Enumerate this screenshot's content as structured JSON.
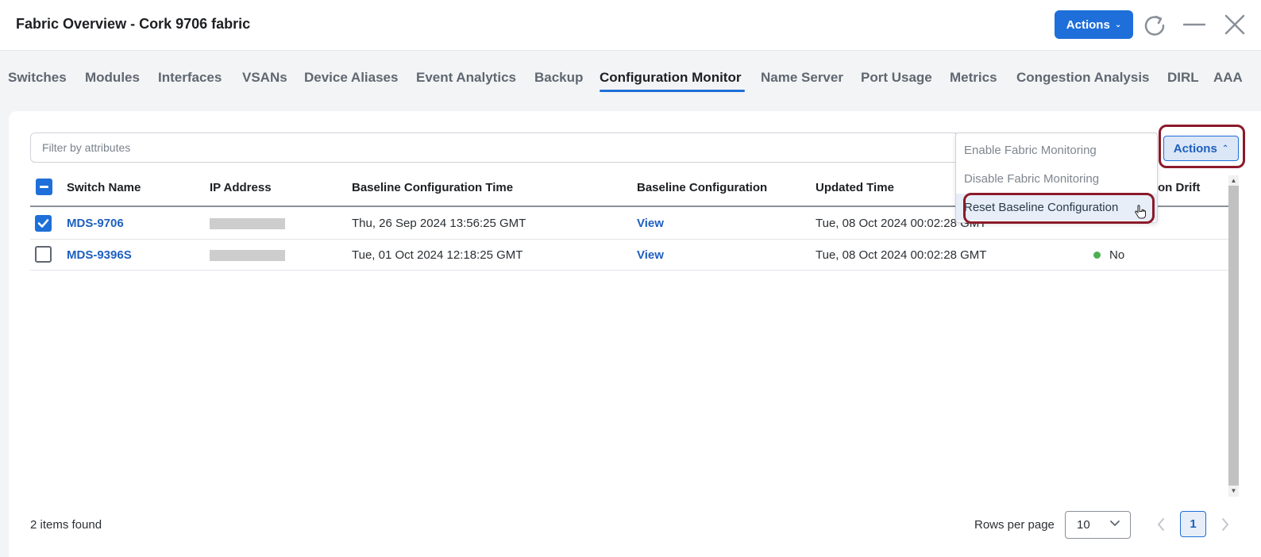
{
  "header": {
    "title": "Fabric Overview - Cork 9706 fabric",
    "actions_label": "Actions"
  },
  "tabs": [
    {
      "label": "Switches"
    },
    {
      "label": "Modules"
    },
    {
      "label": "Interfaces"
    },
    {
      "label": "VSANs"
    },
    {
      "label": "Device Aliases"
    },
    {
      "label": "Event Analytics"
    },
    {
      "label": "Backup"
    },
    {
      "label": "Configuration Monitor",
      "active": true
    },
    {
      "label": "Name Server"
    },
    {
      "label": "Port Usage"
    },
    {
      "label": "Metrics"
    },
    {
      "label": "Congestion Analysis"
    },
    {
      "label": "DIRL"
    },
    {
      "label": "AAA"
    }
  ],
  "filter": {
    "placeholder": "Filter by attributes",
    "value": ""
  },
  "actions_menu": {
    "button_label": "Actions",
    "items": [
      {
        "label": "Enable Fabric Monitoring"
      },
      {
        "label": "Disable Fabric Monitoring"
      },
      {
        "label": "Reset Baseline Configuration",
        "hovered": true
      }
    ]
  },
  "table": {
    "columns": [
      "Switch Name",
      "IP Address",
      "Baseline Configuration Time",
      "Baseline Configuration",
      "Updated Time",
      "on Drift"
    ],
    "rows": [
      {
        "checked": true,
        "switch_name": "MDS-9706",
        "baseline_time": "Thu, 26 Sep 2024 13:56:25 GMT",
        "baseline_config": "View",
        "updated_time": "Tue, 08 Oct 2024 00:02:28 GMT",
        "drift_status_color": "#d9362b"
      },
      {
        "checked": false,
        "switch_name": "MDS-9396S",
        "baseline_time": "Tue, 01 Oct 2024 12:18:25 GMT",
        "baseline_config": "View",
        "updated_time": "Tue, 08 Oct 2024 00:02:28 GMT",
        "drift": "No",
        "drift_status_color": "#4caf50"
      }
    ]
  },
  "footer": {
    "items_found": "2 items found",
    "rows_per_page_label": "Rows per page",
    "rows_per_page_value": "10",
    "current_page": "1"
  },
  "colors": {
    "accent": "#1e6fd9",
    "highlight_outline": "#8b1a2b"
  }
}
